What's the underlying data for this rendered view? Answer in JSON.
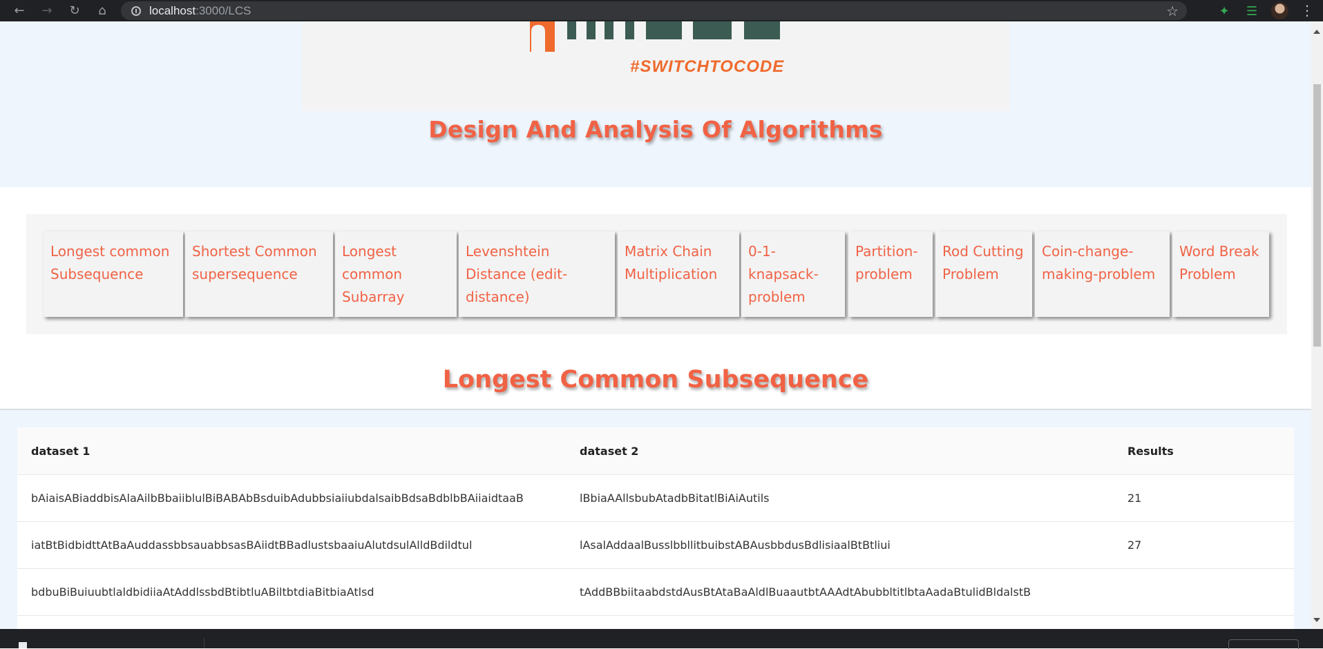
{
  "browser": {
    "url_host": "localhost",
    "url_path": ":3000/LCS",
    "icons": [
      "back-arrow-icon",
      "forward-arrow-icon",
      "reload-icon",
      "home-icon",
      "info-icon",
      "star-icon",
      "puzzle-icon",
      "media-icon",
      "avatar",
      "menu-dots-icon"
    ]
  },
  "hero": {
    "logo_tagline": "#SWITCHTOCODE",
    "title": "Design And Analysis Of Algorithms"
  },
  "nav": {
    "items": [
      {
        "label": "Longest common Subsequence"
      },
      {
        "label": "Shortest Common supersequence"
      },
      {
        "label": "Longest common Subarray"
      },
      {
        "label": "Levenshtein Distance (edit-distance)"
      },
      {
        "label": "Matrix Chain Multiplication"
      },
      {
        "label": "0-1-knapsack-problem"
      },
      {
        "label": "Partition-problem"
      },
      {
        "label": "Rod Cutting Problem"
      },
      {
        "label": "Coin-change-making-problem"
      },
      {
        "label": "Word Break Problem"
      }
    ]
  },
  "section": {
    "title": "Longest Common Subsequence"
  },
  "table": {
    "headers": [
      "dataset 1",
      "dataset 2",
      "Results"
    ],
    "rows": [
      {
        "d1": "bAiaisABiaddbisAlaAilbBbaiiblulBiBABAbBsduibAdubbsiaiiubdalsaibBdsaBdblbBAiiaidtaaB",
        "d2": "lBbiaAAllsbubAtadbBitatlBiAiAutils",
        "result": "21"
      },
      {
        "d1": "iatBtBidbidttAtBaAuddassbbsauabbsasBAiidtBBadlustsbaaiuAlutdsulAlldBdildtul",
        "d2": "lAsalAddaalBusslbbllitbuibstABAusbbdusBdlisiaalBtBtliui",
        "result": "27"
      },
      {
        "d1": "bdbuBiBuiuubtlaldbidiiaAtAddlssbdBtibtluABiltbtdiaBitbiaAtlsd",
        "d2": "tAddBBbiitaabdstdAusBtAtaBaAldlBuaautbtAAAdtAbubbltitlbtaAadaBtulidBldalstB",
        "result": ""
      }
    ]
  },
  "colors": {
    "accent": "#f16245",
    "hero_bg": "#eef5fd",
    "chrome_bg": "#202124",
    "logo_orange": "#ef6a2d",
    "logo_dark": "#3c5b52"
  }
}
